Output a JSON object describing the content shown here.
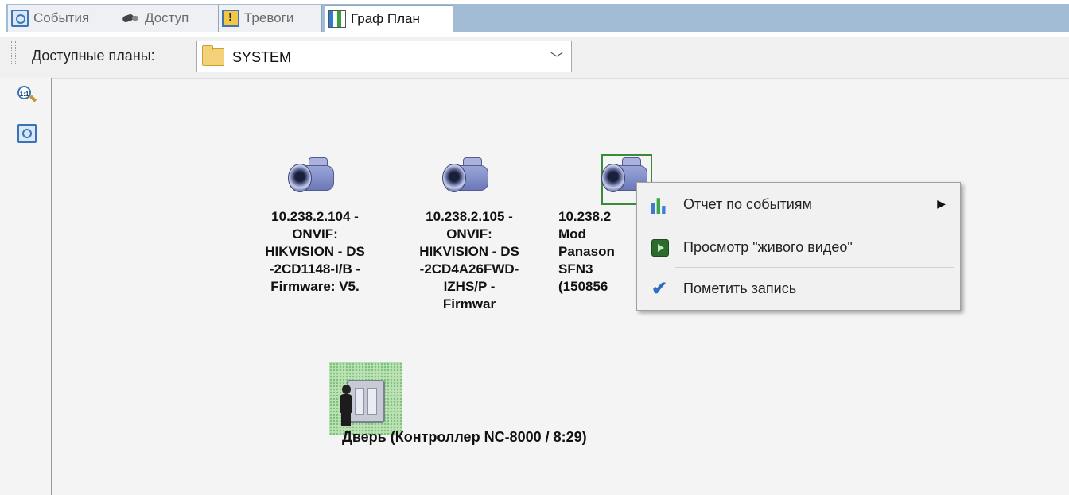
{
  "tabs": [
    {
      "label": "События",
      "icon": "events-icon"
    },
    {
      "label": "Доступ",
      "icon": "access-icon"
    },
    {
      "label": "Тревоги",
      "icon": "alarm-icon"
    },
    {
      "label": "Граф План",
      "icon": "graph-plan-icon",
      "active": true
    }
  ],
  "toolbar": {
    "plans_label": "Доступные планы:",
    "plans_value": "SYSTEM"
  },
  "lefttools": [
    {
      "name": "zoom-1-1",
      "label": "1:1"
    },
    {
      "name": "zoom-fit"
    }
  ],
  "cameras": [
    {
      "label": "10.238.2.104 -\nONVIF:\nHIKVISION - DS\n-2CD1148-I/B -\nFirmware: V5."
    },
    {
      "label": "10.238.2.105 -\nONVIF:\nHIKVISION - DS\n-2CD4A26FWD-\nIZHS/P -\nFirmwar"
    },
    {
      "label": "10.238.2\nMod\nPanason\nSFN3\n(150856"
    }
  ],
  "door": {
    "label": "Дверь (Контроллер NC-8000 / 8:29)"
  },
  "context_menu": {
    "items": [
      {
        "label": "Отчет по событиям",
        "icon": "chart-icon",
        "submenu": true
      },
      {
        "label": "Просмотр \"живого видео\"",
        "icon": "live-video-icon"
      },
      {
        "label": "Пометить запись",
        "icon": "checkmark-icon"
      }
    ],
    "submenu_arrow": "▶"
  },
  "colors": {
    "tab_strip": "#a3bcd6",
    "selection": "#3a8a3a",
    "menu_bg": "#f1f1f1"
  }
}
